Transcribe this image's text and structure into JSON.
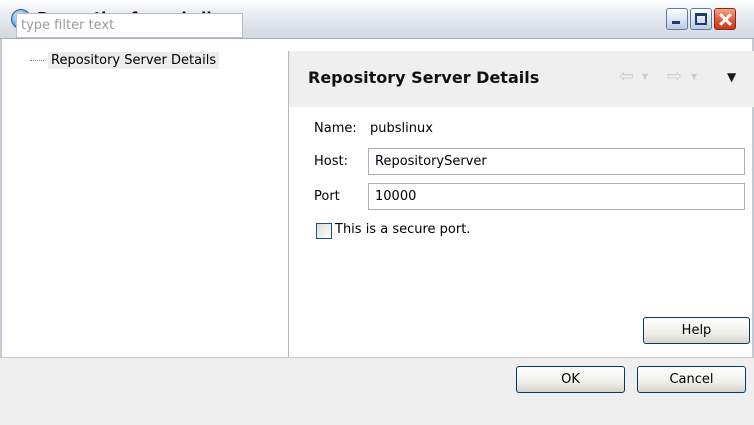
{
  "window": {
    "title": "Properties for pubslinux",
    "buttons": {
      "minimize": "minimize",
      "maximize": "maximize",
      "close": "close"
    }
  },
  "left_panel": {
    "filter_placeholder": "type filter text",
    "filter_value": "",
    "tree_items": [
      {
        "label": "Repository Server Details",
        "selected": true
      }
    ]
  },
  "right_panel": {
    "header_title": "Repository Server Details",
    "nav_icons": [
      "back-arrow-icon",
      "forward-arrow-icon",
      "view-menu-icon"
    ],
    "name_label": "Name:",
    "name_value": "pubslinux",
    "host_label": "Host:",
    "host_value": "RepositoryServer",
    "port_label": "Port",
    "port_value": "10000",
    "secure_port_label": "This is a secure port.",
    "secure_port_checked": false,
    "help_label": "Help"
  },
  "footer": {
    "ok_label": "OK",
    "cancel_label": "Cancel"
  },
  "colors": {
    "header_background": "#efefef",
    "selection_background": "#ececec",
    "button_border": "#003c74",
    "close_button": "#e0593a"
  }
}
